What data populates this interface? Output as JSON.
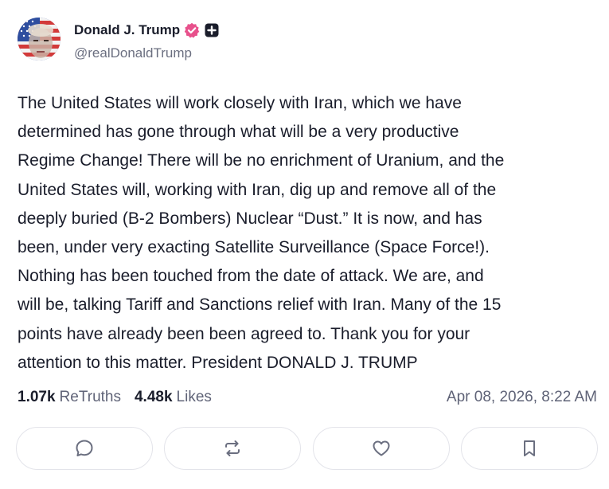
{
  "author": {
    "display_name": "Donald J. Trump",
    "handle": "@realDonaldTrump",
    "verified_badge_icon": "verified-badge-icon",
    "plus_badge_icon": "plus-badge-icon",
    "verified_color": "#e8518c"
  },
  "post": {
    "text": "The United States will work closely with Iran, which we have\ndetermined has gone through what will be a very productive\nRegime Change! There will be no enrichment of Uranium, and the\nUnited States will, working with Iran, dig up and remove all of the\ndeeply buried (B-2 Bombers) Nuclear “Dust.” It is now, and has\nbeen, under very exacting Satellite Surveillance (Space Force!).\nNothing has been touched from the date of attack. We are, and\nwill be, talking Tariff and Sanctions relief with Iran. Many of the 15\npoints have already been been agreed to. Thank you for your\nattention to this matter. President DONALD J. TRUMP"
  },
  "stats": {
    "retruths_count": "1.07k",
    "retruths_label": "ReTruths",
    "likes_count": "4.48k",
    "likes_label": "Likes"
  },
  "timestamp": "Apr 08, 2026, 8:22 AM",
  "actions": [
    {
      "icon": "comment-icon"
    },
    {
      "icon": "retruth-icon"
    },
    {
      "icon": "heart-icon"
    },
    {
      "icon": "bookmark-icon"
    }
  ]
}
